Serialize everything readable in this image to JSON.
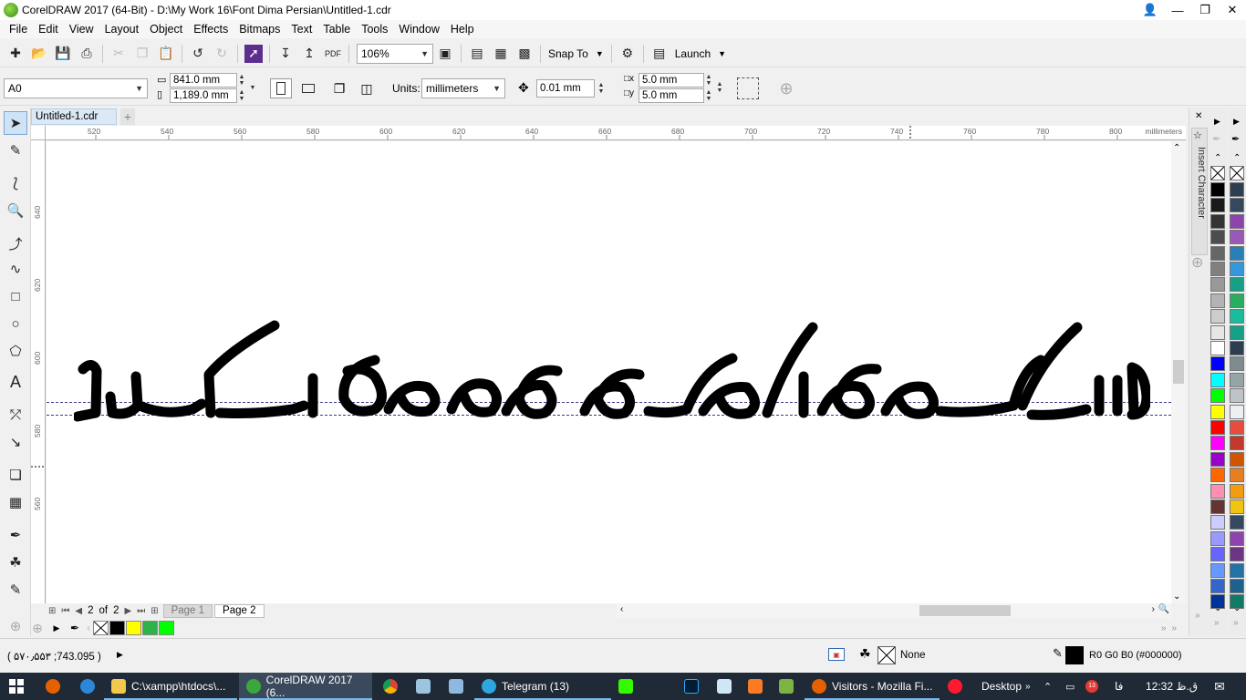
{
  "window": {
    "title": "CorelDRAW 2017 (64-Bit) - D:\\My Work 16\\Font Dima Persian\\Untitled-1.cdr"
  },
  "menu": [
    "File",
    "Edit",
    "View",
    "Layout",
    "Object",
    "Effects",
    "Bitmaps",
    "Text",
    "Table",
    "Tools",
    "Window",
    "Help"
  ],
  "toolbar": {
    "zoom": "106%",
    "snap_to": "Snap To",
    "launch": "Launch",
    "pdf_label": "PDF"
  },
  "propbar": {
    "page_size": "A0",
    "width": "841.0 mm",
    "height": "1,189.0 mm",
    "units_label": "Units:",
    "units_value": "millimeters",
    "nudge": "0.01 mm",
    "dup_x": "5.0 mm",
    "dup_y": "5.0 mm"
  },
  "document": {
    "tab": "Untitled-1.cdr"
  },
  "ruler": {
    "unit": "millimeters",
    "h_ticks": [
      "520",
      "540",
      "560",
      "580",
      "600",
      "620",
      "640",
      "660",
      "680",
      "700",
      "720",
      "740",
      "760",
      "780",
      "800"
    ],
    "v_ticks": [
      "640",
      "620",
      "600",
      "580",
      "560"
    ]
  },
  "pagenav": {
    "current": "2",
    "of": "of",
    "total": "2",
    "pages": [
      "Page 1",
      "Page 2"
    ]
  },
  "docker": {
    "label": "Insert Character"
  },
  "status": {
    "coords": "( ۵۷۰٫۵۵۳ ;743.095 )",
    "fill_label": "None",
    "outline_color": "R0 G0 B0 (#000000)"
  },
  "taskbar": {
    "items": [
      {
        "label": "C:\\xampp\\htdocs\\...",
        "color": "#f2c94c"
      },
      {
        "label": "CorelDRAW 2017 (6...",
        "color": "#3aa83a"
      },
      {
        "label": "Telegram (13)",
        "color": "#2ea6e0"
      },
      {
        "label": "Visitors - Mozilla Fi...",
        "color": "#e66000"
      }
    ],
    "desktop": "Desktop",
    "lang": "فا",
    "time": "12:32 ق.ظ",
    "badge": "13"
  },
  "palette_colors": {
    "doc": [
      "#000000",
      "#ffff00",
      "#2db34a",
      "#00ff00"
    ],
    "main": [
      "#000000",
      "#1a1a1a",
      "#333333",
      "#4d4d4d",
      "#666666",
      "#808080",
      "#999999",
      "#b3b3b3",
      "#cccccc",
      "#e6e6e6",
      "#ffffff",
      "#0000ff",
      "#00ffff",
      "#00ff00",
      "#ffff00",
      "#ff0000",
      "#ff00ff",
      "#9900cc",
      "#ff6600",
      "#ff8fb0",
      "#663333",
      "#ccccff",
      "#9999ff",
      "#6666ff",
      "#6699ff",
      "#3366cc",
      "#003399"
    ],
    "second": [
      "#2c3e50",
      "#34495e",
      "#8e44ad",
      "#9b59b6",
      "#2980b9",
      "#3498db",
      "#16a085",
      "#27ae60",
      "#1abc9c",
      "#16a085",
      "#2c3e50",
      "#7f8c8d",
      "#95a5a6",
      "#bdc3c7",
      "#ecf0f1",
      "#e74c3c",
      "#c0392b",
      "#d35400",
      "#e67e22",
      "#f39c12",
      "#f1c40f",
      "#34495e",
      "#8e44ad",
      "#6c3483",
      "#2471a3",
      "#1f618d",
      "#117a65"
    ]
  }
}
